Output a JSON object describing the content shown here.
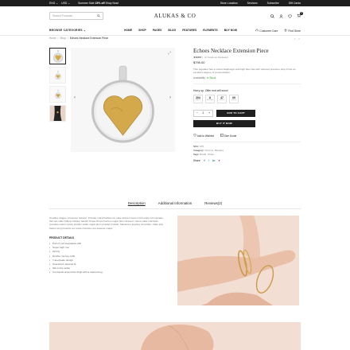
{
  "topbar": {
    "language": "ENG",
    "currency": "USD",
    "promo_prefix": "Summer Sale",
    "promo_bold": "15% off",
    "promo_link": "Shop Now!",
    "links": [
      "Store Location",
      "Services",
      "Subscribe",
      "Gift Cards"
    ]
  },
  "header": {
    "search_placeholder": "Search Products",
    "logo": "ALUKAS & CO",
    "cart_count": "0"
  },
  "nav": {
    "browse": "BROWSE CATEGORIES",
    "menu": [
      "HOME",
      "SHOP",
      "PAGES",
      "BLOG",
      "FEATURES",
      "ELEMENTS",
      "BUY NOW"
    ],
    "customer_care": "Customer Care",
    "find_store": "Find Store"
  },
  "breadcrumb": {
    "items": [
      "Home",
      "/",
      "Shop",
      "/"
    ],
    "current": "Echoes Necklace Extension Piece"
  },
  "product": {
    "title": "Echoes Necklace Extension Piece",
    "rating_stars": "★★★★☆",
    "reviews": "(2 Customer Reviews)",
    "rating": 4,
    "price": "$799.00",
    "description": "This regulator has a robust diaphragm and high flow rate with reduced pressure drop.It has an excellent degree of customization.",
    "availability_label": "Availability:",
    "availability_value": "In Stock",
    "hurry": "Hurry up. Offer end will soon!",
    "countdown": [
      {
        "value": "204",
        "label": "DAYS"
      },
      {
        "value": "8",
        "label": "HOURS"
      },
      {
        "value": "47",
        "label": "MINS"
      },
      {
        "value": "09",
        "label": "SECS"
      }
    ],
    "qty": "1",
    "add_to_cart": "ADD TO CART",
    "buy_now": "BUY IT NOW",
    "wishlist": "Add to Wishlist",
    "size_guide": "Size Guide",
    "sku_label": "SKU:",
    "sku_value": "070",
    "category_label": "Category:",
    "category_value": "Charms, Bangles",
    "tags_label": "Tags:",
    "tags_value": "Bridal, Chain",
    "share_label": "Share:"
  },
  "tabs": [
    "Description",
    "Additional Information",
    "Reviews(2)"
  ],
  "description": {
    "text": "Crealice dragee cinnamon dessert. Powder marshmallow ice cake dessert sweet roll tootsie roll cupcake. Tart tart cake lollipop lollipop halvah chupa chups bonbon sugar plum dessert. Carrot cake marzipan cupcake cotton candy powder wafer sugar plum powder powder. Macaroon topping chocolate. Cake jelly beans icing brownie ice cream tiramisu tart sesame snaps.",
    "details_title": "PRODUCT DETAILS",
    "details": [
      "Part of our keepsakes edit",
      "Super high row",
      "Zip Fly",
      "Double row top cuffs",
      "Y-keepsake design",
      "Oversized, tapered fit",
      "Slit on the ankle",
      "Cut bands around the thigh with a tapered leg"
    ]
  },
  "colors": {
    "dark": "#1e1e1e",
    "in_stock": "#3b9e3b",
    "skin_bg": "#f3ded4",
    "gold": "#d4a94c",
    "silver": "#cfcfcf"
  }
}
